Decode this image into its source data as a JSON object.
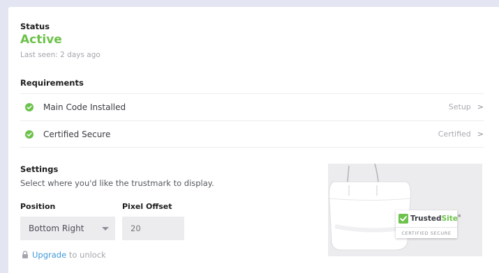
{
  "status": {
    "heading": "Status",
    "value": "Active",
    "last_seen": "Last seen: 2 days ago",
    "active_color": "#6cc24a"
  },
  "requirements": {
    "heading": "Requirements",
    "items": [
      {
        "label": "Main Code Installed",
        "action": "Setup",
        "icon": "check-circle-icon",
        "done": true
      },
      {
        "label": "Certified Secure",
        "action": "Certified",
        "icon": "check-circle-icon",
        "done": true
      }
    ]
  },
  "settings": {
    "heading": "Settings",
    "description": "Select where you'd like the trustmark to display.",
    "position_label": "Position",
    "position_value": "Bottom Right",
    "offset_label": "Pixel Offset",
    "offset_placeholder": "20",
    "upgrade_link": "Upgrade",
    "upgrade_suffix": " to unlock",
    "lock_icon": "lock-icon"
  },
  "preview": {
    "badge_brand": "Trusted",
    "badge_brand_accent": "Site",
    "badge_trademark": "®",
    "badge_subtitle": "CERTIFIED SECURE",
    "badge_icon": "check-square-icon"
  },
  "colors": {
    "accent_green": "#6cc24a",
    "link_blue": "#3f98d8",
    "page_background": "#e4e5f2"
  }
}
